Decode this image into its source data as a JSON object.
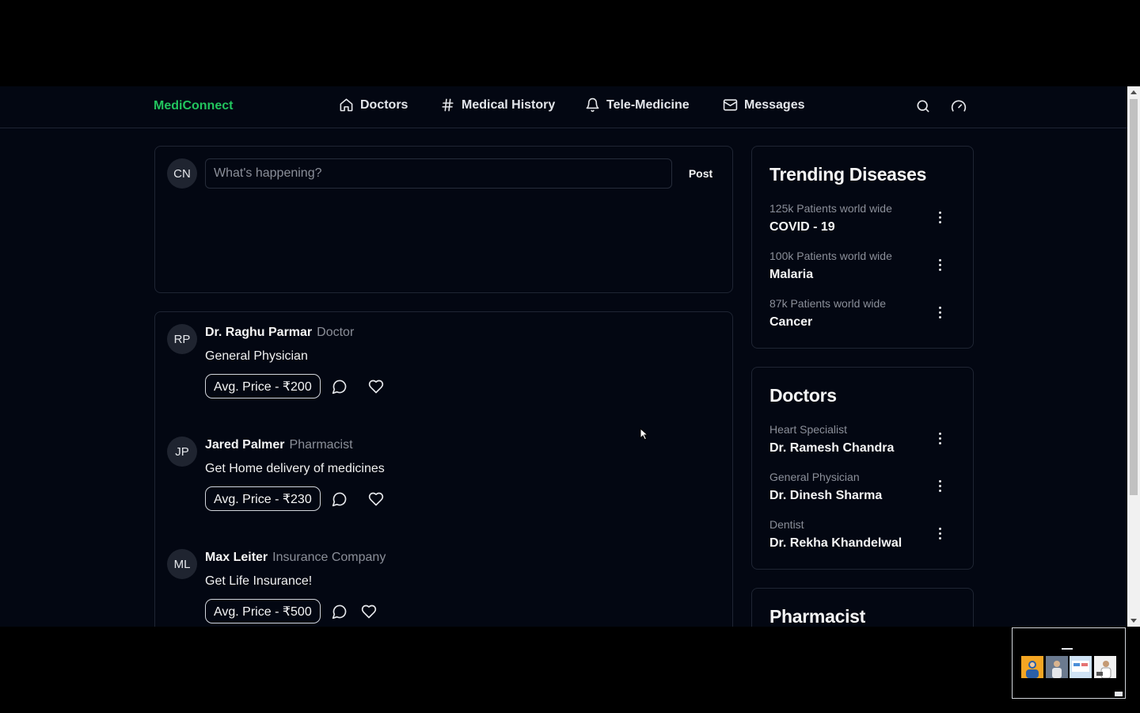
{
  "nav": {
    "brand": "MediConnect",
    "links": [
      {
        "label": "Doctors",
        "icon": "home-icon"
      },
      {
        "label": "Medical History",
        "icon": "hash-icon"
      },
      {
        "label": "Tele-Medicine",
        "icon": "bell-icon"
      },
      {
        "label": "Messages",
        "icon": "mail-icon"
      }
    ],
    "actions": [
      "search-icon",
      "gauge-icon"
    ]
  },
  "compose": {
    "avatar": "CN",
    "placeholder": "What's happening?",
    "post_label": "Post"
  },
  "posts": [
    {
      "initials": "RP",
      "name": "Dr. Raghu Parmar",
      "role": "Doctor",
      "text": "General Physician",
      "price": "Avg. Price - ₹200"
    },
    {
      "initials": "JP",
      "name": "Jared Palmer",
      "role": "Pharmacist",
      "text": "Get Home delivery of medicines",
      "price": "Avg. Price - ₹230"
    },
    {
      "initials": "ML",
      "name": "Max Leiter",
      "role": "Insurance Company",
      "text": "Get Life Insurance!",
      "price": "Avg. Price - ₹500"
    }
  ],
  "trending": {
    "title": "Trending Diseases",
    "items": [
      {
        "sub": "125k Patients world wide",
        "main": "COVID - 19"
      },
      {
        "sub": "100k Patients world wide",
        "main": "Malaria"
      },
      {
        "sub": "87k Patients world wide",
        "main": "Cancer"
      }
    ]
  },
  "doctors": {
    "title": "Doctors",
    "items": [
      {
        "sub": "Heart Specialist",
        "main": "Dr. Ramesh Chandra"
      },
      {
        "sub": "General Physician",
        "main": "Dr. Dinesh Sharma"
      },
      {
        "sub": "Dentist",
        "main": "Dr. Rekha Khandelwal"
      }
    ]
  },
  "pharmacist": {
    "title": "Pharmacist"
  },
  "colors": {
    "brand": "#22c55e",
    "background": "#030712",
    "border": "#1f2533",
    "muted_text": "#8b8f99"
  }
}
